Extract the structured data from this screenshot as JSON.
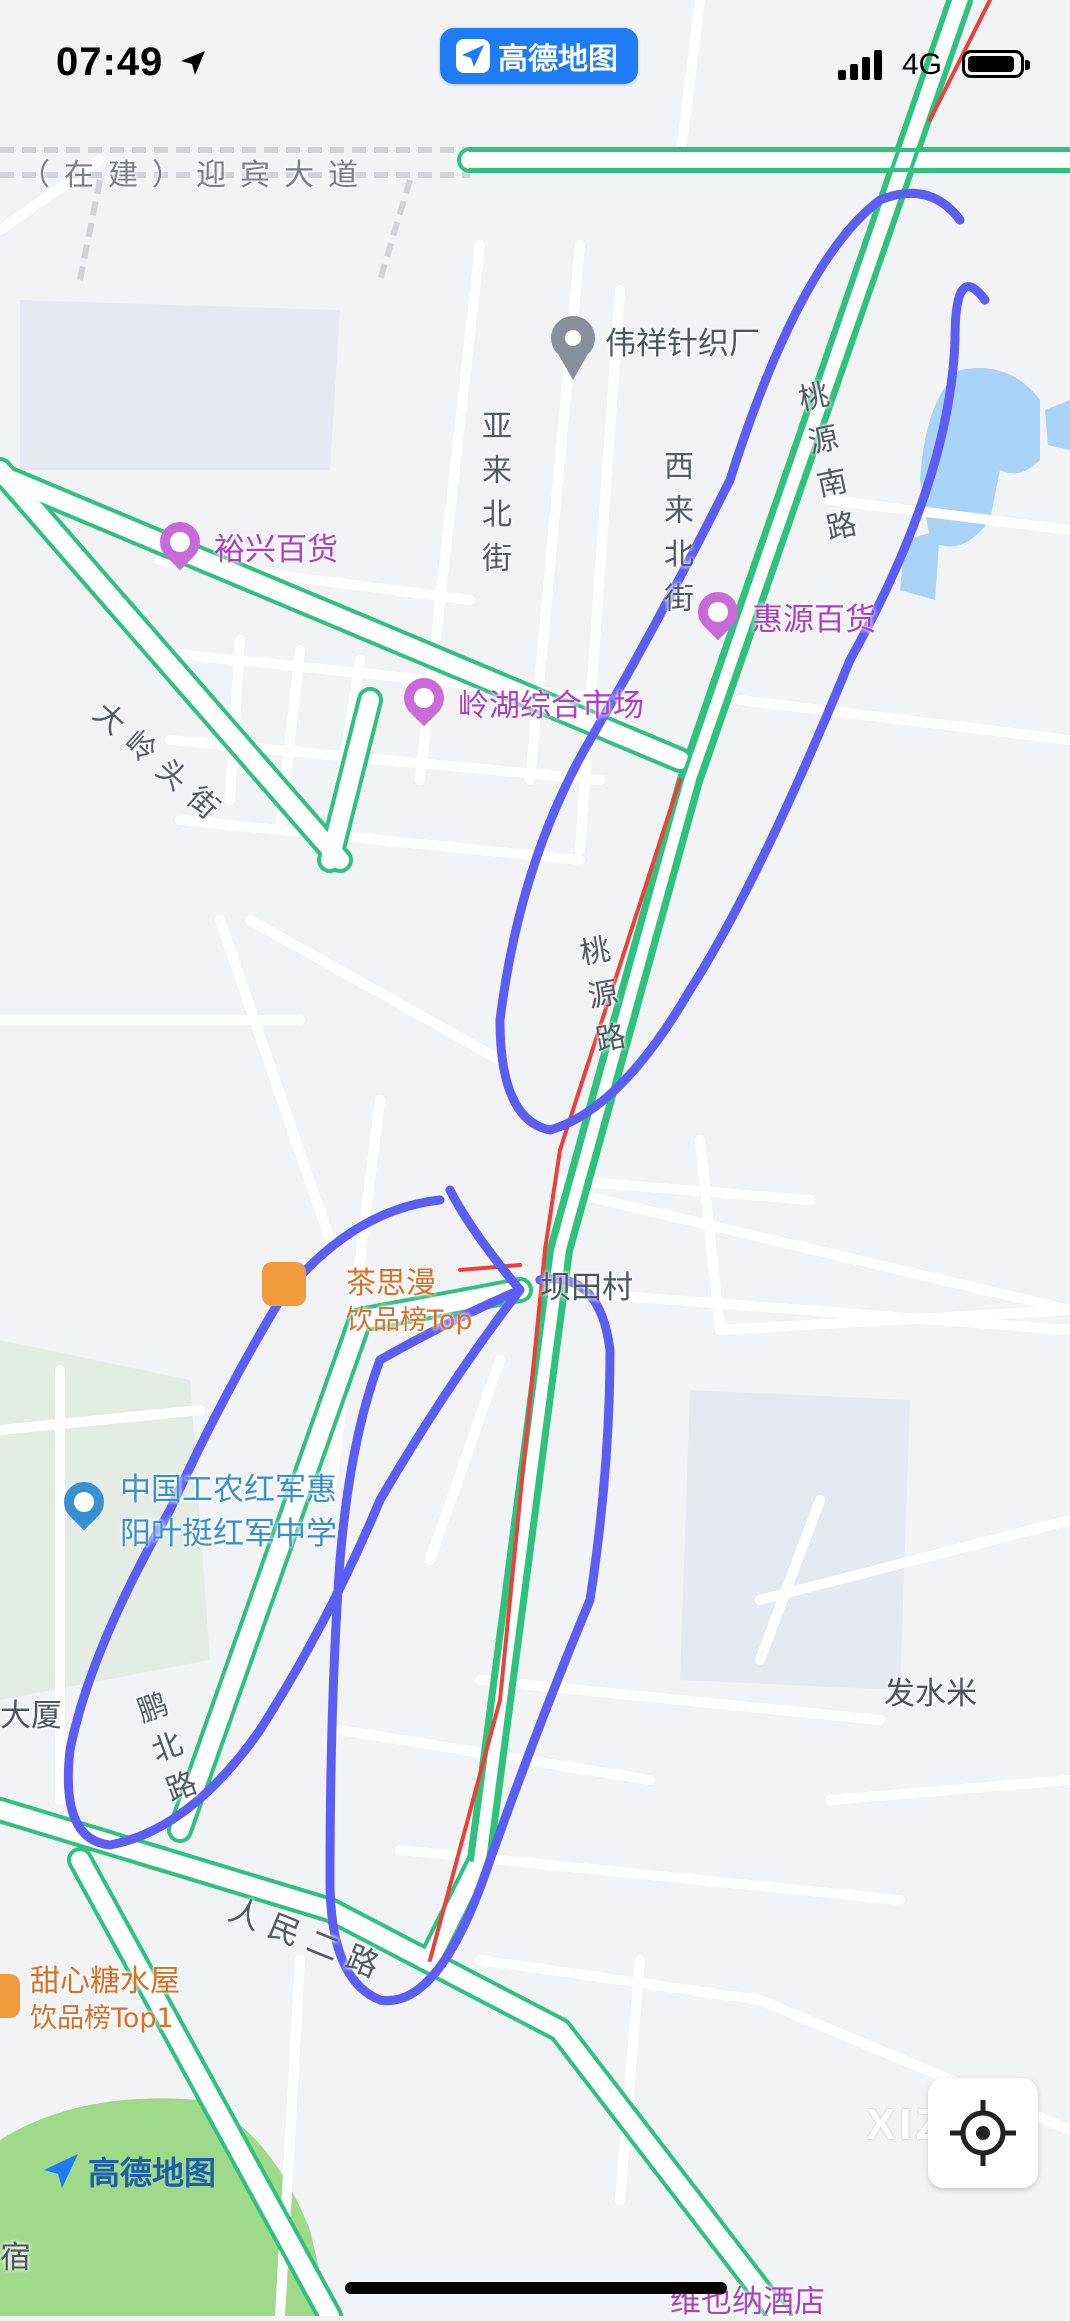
{
  "status_bar": {
    "time": "07:49",
    "app_name": "高德地图",
    "network": "4G"
  },
  "map": {
    "road_labels": {
      "yingbin": "（在建）迎宾大道",
      "yalai": "亚来北街",
      "xilai": "西来北街",
      "taoyuan_south": "桃源南路",
      "taoyuan": "桃源路",
      "dalingtou": "大岭头街",
      "pengbei": "鹏北路",
      "renmin": "人民二路"
    },
    "pois": {
      "weixiang": "伟祥针织厂",
      "yuxing": "裕兴百货",
      "huiyuan": "惠源百货",
      "linghu": "岭湖综合市场",
      "chasiman": "茶思漫",
      "chasiman_sub": "饮品榜Top",
      "village": "坝田村",
      "school_line1": "中国工农红军惠",
      "school_line2": "阳叶挺红军中学",
      "dasha": "大厦",
      "fashuimi": "发水米",
      "tianxin": "甜心糖水屋",
      "tianxin_sub": "饮品榜Top1",
      "hotel": "维也纳酒店",
      "su": "宿"
    },
    "colors": {
      "road_green": "#2ec27e",
      "route_red": "#e8423a",
      "annotation": "#5b5ef0",
      "poi_purple": "#b03cc8",
      "water": "#a9d3f7",
      "park": "#9fd98a"
    }
  },
  "logo": {
    "text": "高德地图"
  },
  "watermark": {
    "text": "XIZI"
  },
  "controls": {
    "locate_icon": "crosshair-icon"
  }
}
